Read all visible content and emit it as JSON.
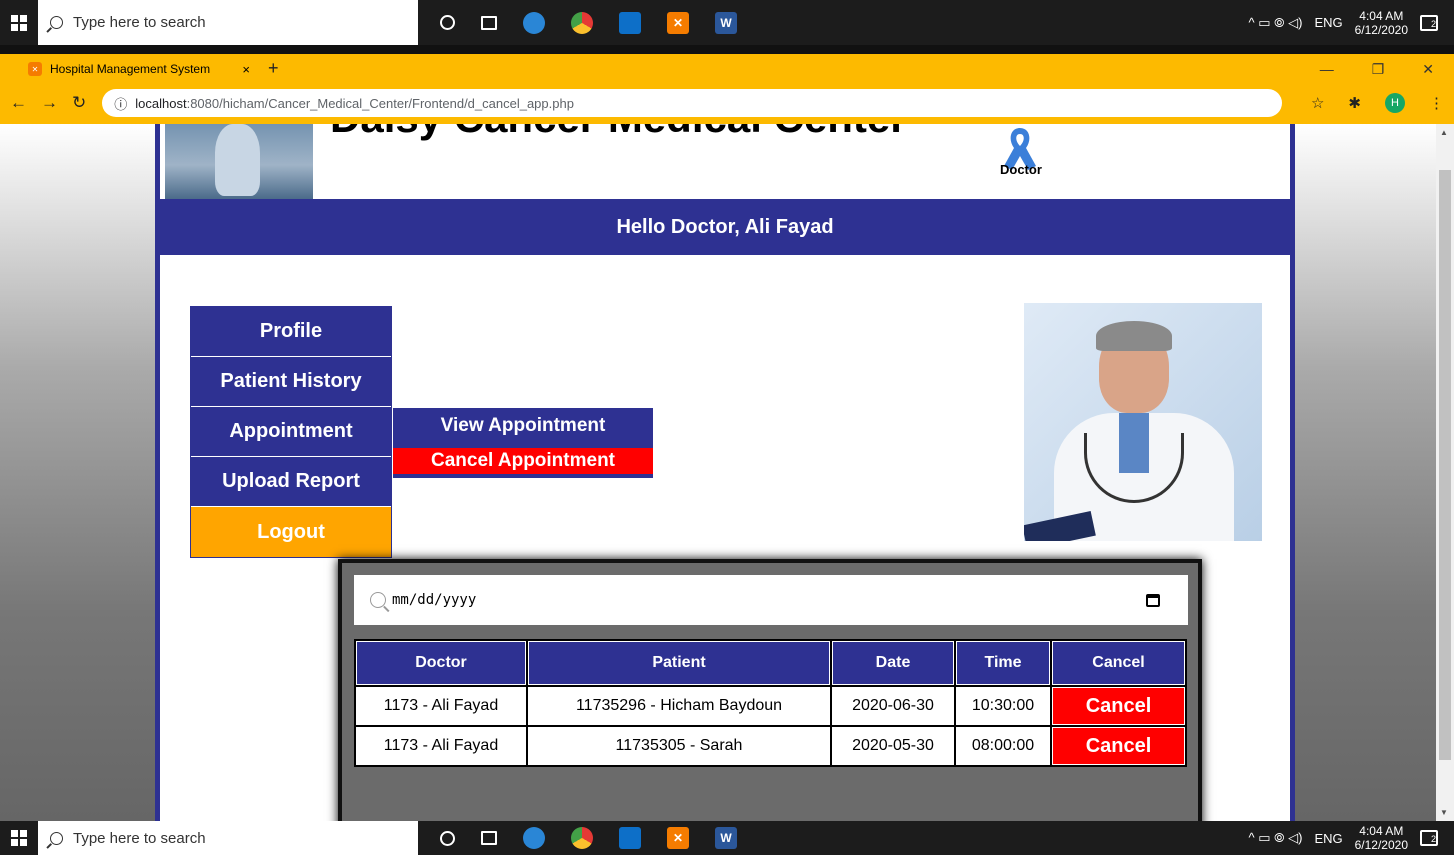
{
  "taskbar": {
    "search_placeholder": "Type here to search",
    "tray_lang": "ENG",
    "tray_symbols": "^  ▭  ⦾  ◁)",
    "time": "4:04 AM",
    "date": "6/12/2020",
    "notify_count": "2",
    "apps": [
      "cortana-icon",
      "task-view-icon",
      "edge-icon",
      "chrome-icon",
      "mail-icon",
      "xampp-icon",
      "word-icon"
    ]
  },
  "browser": {
    "tab_title": "Hospital Management System",
    "tab_close": "×",
    "new_tab": "+",
    "url_host": "localhost",
    "url_path": ":8080/hicham/Cancer_Medical_Center/Frontend/d_cancel_app.php",
    "profile_initial": "H",
    "accent": "#fdba00"
  },
  "site": {
    "title": "Daisy Cancer Medical Center",
    "role_label": "Doctor",
    "greeting": "Hello Doctor, Ali Fayad",
    "brand_color": "#2e3192"
  },
  "menu": {
    "items": [
      {
        "label": "Profile"
      },
      {
        "label": "Patient History"
      },
      {
        "label": "Appointment"
      },
      {
        "label": "Upload Report"
      },
      {
        "label": "Logout"
      }
    ],
    "submenu": [
      {
        "label": "View Appointment"
      },
      {
        "label": "Cancel Appointment"
      }
    ]
  },
  "filter": {
    "date_placeholder": "mm/dd/yyyy"
  },
  "table": {
    "headers": [
      "Doctor",
      "Patient",
      "Date",
      "Time",
      "Cancel"
    ],
    "rows": [
      {
        "doctor": "1173 - Ali Fayad",
        "patient": "11735296 - Hicham Baydoun",
        "date": "2020-06-30",
        "time": "10:30:00",
        "action": "Cancel"
      },
      {
        "doctor": "1173 - Ali Fayad",
        "patient": "11735305 - Sarah",
        "date": "2020-05-30",
        "time": "08:00:00",
        "action": "Cancel"
      }
    ]
  }
}
